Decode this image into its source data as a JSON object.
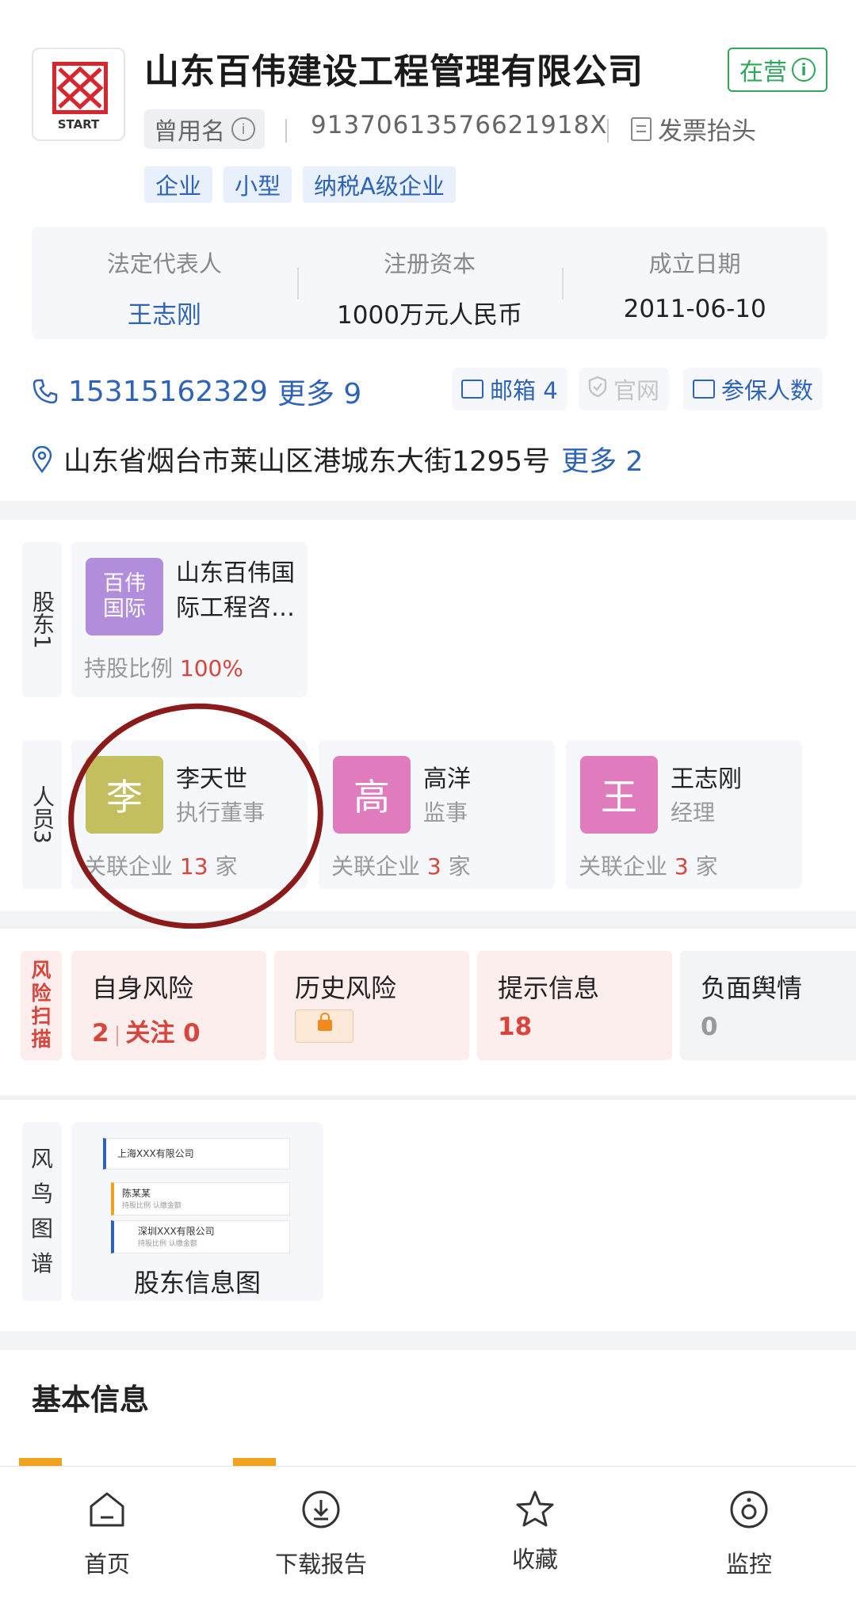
{
  "company": {
    "logo_text": "START",
    "name": "山东百伟建设工程管理有限公司",
    "status": "在营",
    "status_info_icon": "info-icon",
    "former_name_label": "曾用名",
    "credit_code": "91370613576621918X",
    "invoice_label": "发票抬头",
    "tags": [
      "企业",
      "小型",
      "纳税A级企业"
    ]
  },
  "summary": {
    "legal_rep_label": "法定代表人",
    "legal_rep_value": "王志刚",
    "capital_label": "注册资本",
    "capital_value": "1000万元人民币",
    "founded_label": "成立日期",
    "founded_value": "2011-06-10"
  },
  "contact": {
    "phone": "15315162329",
    "phone_more": "更多 9",
    "email_label": "邮箱 4",
    "website_label": "官网",
    "insured_label": "参保人数",
    "address": "山东省烟台市莱山区港城东大街1295号",
    "address_more": "更多 2"
  },
  "shareholders": {
    "label": "股东1",
    "items": [
      {
        "avatar_text": "百伟国际",
        "name": "山东百伟国际工程咨…",
        "ratio_label": "持股比例",
        "ratio": "100%",
        "avatar_color": "#b18ddb"
      }
    ]
  },
  "personnel": {
    "label": "人员3",
    "items": [
      {
        "avatar": "李",
        "name": "李天世",
        "role": "执行董事",
        "rel_pre": "关联企业",
        "rel_num": "13",
        "rel_post": "家",
        "avatar_color": "#c4bf5e"
      },
      {
        "avatar": "高",
        "name": "高洋",
        "role": "监事",
        "rel_pre": "关联企业",
        "rel_num": "3",
        "rel_post": "家",
        "avatar_color": "#e07cbe"
      },
      {
        "avatar": "王",
        "name": "王志刚",
        "role": "经理",
        "rel_pre": "关联企业",
        "rel_num": "3",
        "rel_post": "家",
        "avatar_color": "#e07cbe"
      }
    ]
  },
  "risk": {
    "label": "风险扫描",
    "self_title": "自身风险",
    "self_count": "2",
    "self_follow": "关注 0",
    "history_title": "历史风险",
    "tips_title": "提示信息",
    "tips_count": "18",
    "negative_title": "负面舆情",
    "negative_count": "0"
  },
  "graph": {
    "label": "风鸟图谱",
    "caption": "股东信息图",
    "mini_company_1": "上海XXX有限公司",
    "mini_person": "陈某某",
    "mini_company_2": "深圳XXX有限公司",
    "mini_sub": "持股比例  认缴金额"
  },
  "basic": {
    "title": "基本信息"
  },
  "nav": {
    "home": "首页",
    "download": "下载报告",
    "favorite": "收藏",
    "monitor": "监控"
  },
  "colors": {
    "accent": "#2d63b8",
    "status_green": "#2ea85a",
    "risk_red": "#d9453b",
    "annotation_circle": "#8b1a1a"
  }
}
